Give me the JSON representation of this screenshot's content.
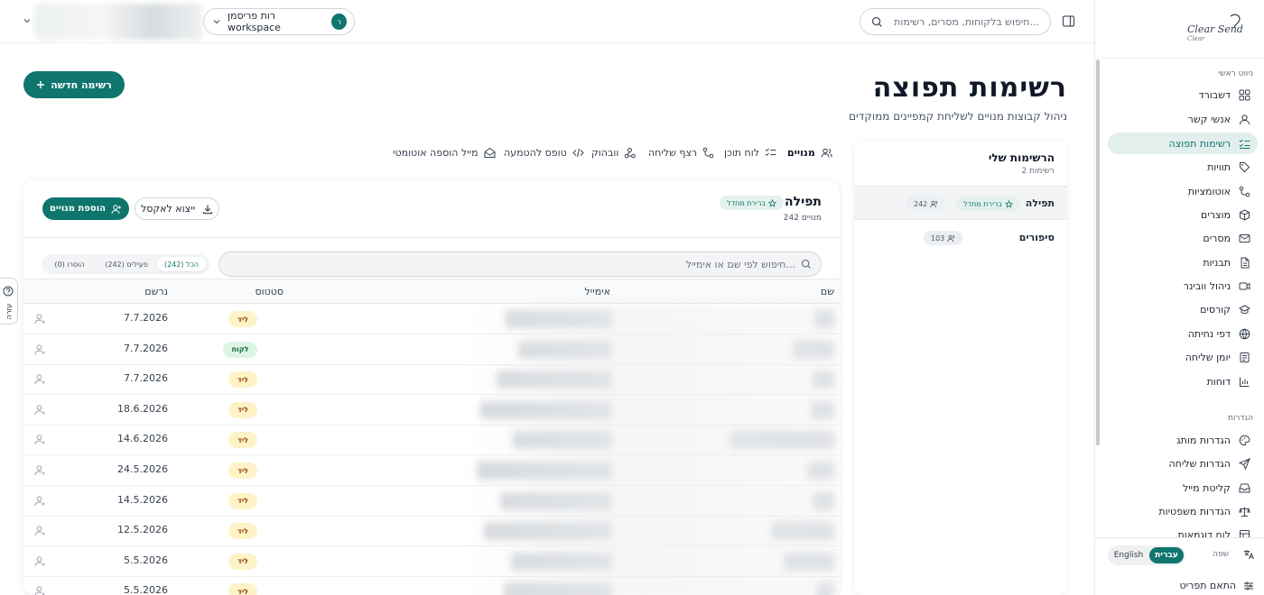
{
  "app": {
    "logo_text": "Clear Send",
    "logo_sub": "Clear"
  },
  "topbar": {
    "search_placeholder": "חיפוש בלקוחות, מסרים, רשימות...",
    "workspace_label": "רות פריסמן workspace",
    "workspace_avatar": "ר"
  },
  "sidebar": {
    "main_title": "ניווט ראשי",
    "items": [
      {
        "label": "דשבורד",
        "icon": "grid-icon"
      },
      {
        "label": "אנשי קשר",
        "icon": "user-icon"
      },
      {
        "label": "רשימות תפוצה",
        "icon": "list-check-icon",
        "active": true
      },
      {
        "label": "תוויות",
        "icon": "tag-icon"
      },
      {
        "label": "אוטומציות",
        "icon": "workflow-icon"
      },
      {
        "label": "מוצרים",
        "icon": "box-icon"
      },
      {
        "label": "מסרים",
        "icon": "mail-icon"
      },
      {
        "label": "תבניות",
        "icon": "file-icon"
      },
      {
        "label": "ניהול וובינר",
        "icon": "video-icon"
      },
      {
        "label": "קורסים",
        "icon": "graduation-cap-icon"
      },
      {
        "label": "דפי נחיתה",
        "icon": "globe-icon"
      },
      {
        "label": "יומן שליחה",
        "icon": "history-icon"
      },
      {
        "label": "דוחות",
        "icon": "bar-chart-icon"
      }
    ],
    "settings_title": "הגדרות",
    "settings_items": [
      {
        "label": "הגדרות מותג",
        "icon": "palette-icon"
      },
      {
        "label": "הגדרות שליחה",
        "icon": "send-icon"
      },
      {
        "label": "קליטת מייל",
        "icon": "inbox-icon"
      },
      {
        "label": "הגדרות משפטיות",
        "icon": "scale-icon"
      },
      {
        "label": "לוח דוגמאות",
        "icon": "layout-icon"
      }
    ],
    "language_label": "שפה",
    "language_options": [
      "עברית",
      "English"
    ],
    "language_selected": "עברית",
    "customize_menu_label": "התאם תפריט"
  },
  "page": {
    "title": "רשימות תפוצה",
    "subtitle": "ניהול קבוצות מנויים לשליחת קמפיינים ממוקדים",
    "new_list_button": "רשימה חדשה",
    "tabs": [
      {
        "label": "מנויים",
        "icon": "users-icon",
        "active": true
      },
      {
        "label": "לוח תוכן",
        "icon": "list-check-icon"
      },
      {
        "label": "רצף שליחה",
        "icon": "workflow-icon"
      },
      {
        "label": "וובהוק",
        "icon": "webhook-icon"
      },
      {
        "label": "טופס להטמעה",
        "icon": "code-icon"
      },
      {
        "label": "מייל הוספה אוטומטי",
        "icon": "mail-open-icon"
      }
    ]
  },
  "lists_panel": {
    "title": "הרשימות שלי",
    "count_label": "2 רשימות",
    "lists": [
      {
        "name": "תפילה",
        "badge": "ברירת מחדל",
        "count": "242",
        "selected": true
      },
      {
        "name": "סיפורים",
        "badge": "",
        "count": "103"
      }
    ]
  },
  "list_detail": {
    "name": "תפילה",
    "badge": "ברירת מחדל",
    "subscribers_label": "242 מנויים",
    "export_button": "ייצוא לאקסל",
    "add_subscribers_button": "הוספת מנויים",
    "search_placeholder": "חיפוש לפי שם או אימייל...",
    "filters": [
      {
        "label": "הכל (242)",
        "active": true
      },
      {
        "label": "פעילים (242)"
      },
      {
        "label": "הוסרו (0)"
      }
    ],
    "columns": [
      "שם",
      "אימייל",
      "סטטוס",
      "נרשם"
    ],
    "rows": [
      {
        "status": "ליד",
        "type": "lead",
        "date": "7.7.2026"
      },
      {
        "status": "לקוח",
        "type": "cust",
        "date": "7.7.2026"
      },
      {
        "status": "ליד",
        "type": "lead",
        "date": "7.7.2026"
      },
      {
        "status": "ליד",
        "type": "lead",
        "date": "18.6.2026"
      },
      {
        "status": "ליד",
        "type": "lead",
        "date": "14.6.2026"
      },
      {
        "status": "ליד",
        "type": "lead",
        "date": "24.5.2026"
      },
      {
        "status": "ליד",
        "type": "lead",
        "date": "14.5.2026"
      },
      {
        "status": "ליד",
        "type": "lead",
        "date": "12.5.2026"
      },
      {
        "status": "ליד",
        "type": "lead",
        "date": "5.5.2026"
      },
      {
        "status": "ליד",
        "type": "lead",
        "date": "5.5.2026"
      }
    ]
  },
  "help_tab_label": "עזרה",
  "colors": {
    "accent": "#0f766e",
    "accent_soft": "#e3efec",
    "lead_bg": "#fdf3c7",
    "customer_bg": "#dcf5e7"
  }
}
